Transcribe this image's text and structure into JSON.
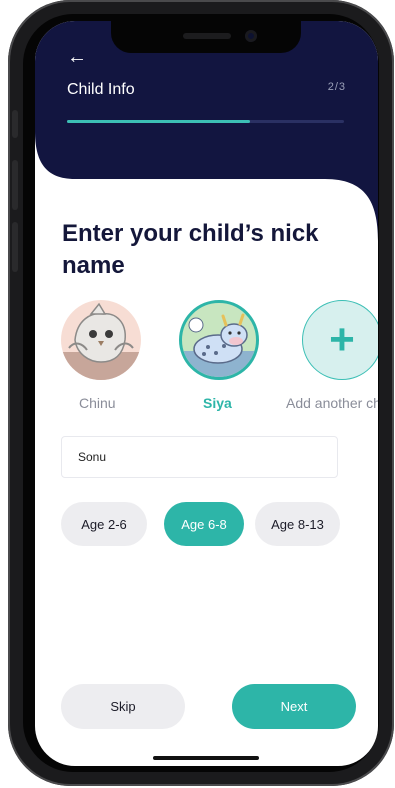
{
  "header": {
    "back_icon": "arrow-left-icon",
    "back_glyph": "←",
    "title": "Child Info",
    "step": "2/3",
    "progress_fraction": 0.66
  },
  "heading": "Enter your child’s nick name",
  "children": [
    {
      "name": "Chinu",
      "selected": false,
      "avatar": "owl-avatar"
    },
    {
      "name": "Siya",
      "selected": true,
      "avatar": "cow-avatar"
    }
  ],
  "add_child": {
    "label": "Add another ch",
    "icon": "plus-icon",
    "glyph": "+"
  },
  "nickname_input": {
    "value": "Sonu"
  },
  "age_options": [
    {
      "label": "Age 2-6",
      "selected": false
    },
    {
      "label": "Age 6-8",
      "selected": true
    },
    {
      "label": "Age 8-13",
      "selected": false
    }
  ],
  "actions": {
    "skip_label": "Skip",
    "next_label": "Next"
  },
  "colors": {
    "header_bg": "#121540",
    "accent": "#2db5a8",
    "chip_bg": "#ededf0"
  }
}
